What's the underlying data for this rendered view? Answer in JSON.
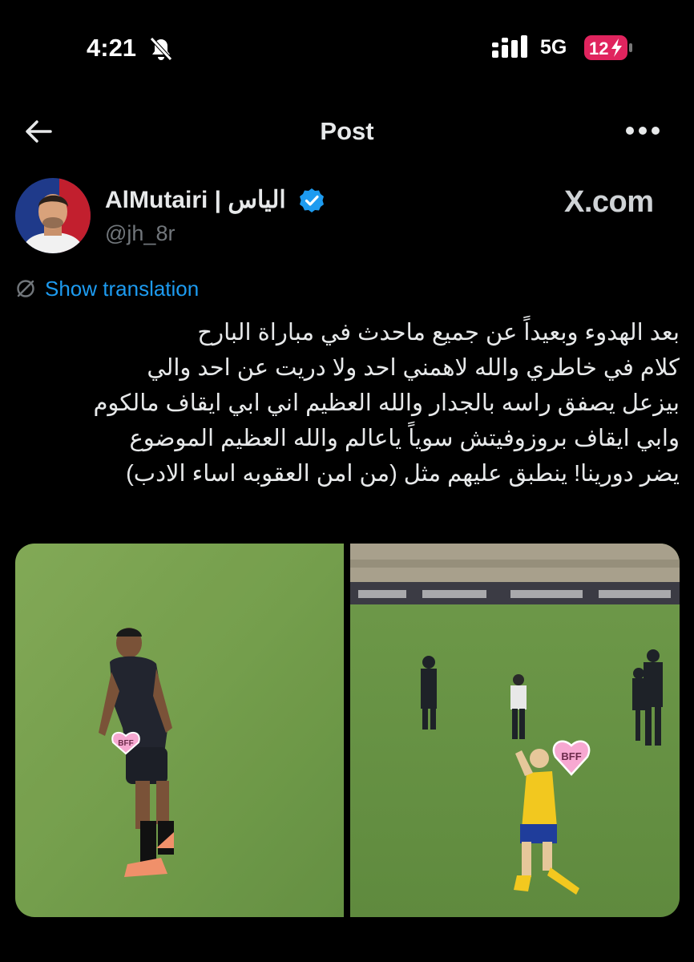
{
  "status_bar": {
    "time": "4:21",
    "network": "5G",
    "battery": "12",
    "icons": [
      "bell-slash-icon",
      "signal-icon",
      "battery-charging-icon"
    ]
  },
  "nav": {
    "title": "Post",
    "icons": [
      "back-arrow-icon",
      "more-icon"
    ]
  },
  "post": {
    "author_name": "AlMutairi | الياس",
    "handle": "@jh_8r",
    "watermark": "X.com",
    "show_translation": "Show translation",
    "text_lines": [
      "بعد الهدوء وبعيداً عن جميع ماحدث في مباراة البارح",
      "كلام في خاطري والله لاهمني احد ولا دريت عن احد والي",
      "بيزعل يصفق راسه بالجدار والله العظيم اني ابي ايقاف مالكوم",
      "وابي ايقاف بروزوفيتش سوياً ياعالم والله العظيم الموضوع",
      "يضر دورينا! ينطبق عليهم مثل (من امن العقوبه اساء الادب)"
    ],
    "media": [
      {
        "sticker": "BFF",
        "description": "player-dark-kit"
      },
      {
        "sticker": "BFF",
        "description": "player-yellow-kit"
      }
    ]
  },
  "colors": {
    "background": "#000000",
    "text": "#e7e9ea",
    "secondary": "#71767b",
    "link": "#1d9bf0",
    "verified": "#1d9bf0",
    "battery": "#e0245e"
  }
}
